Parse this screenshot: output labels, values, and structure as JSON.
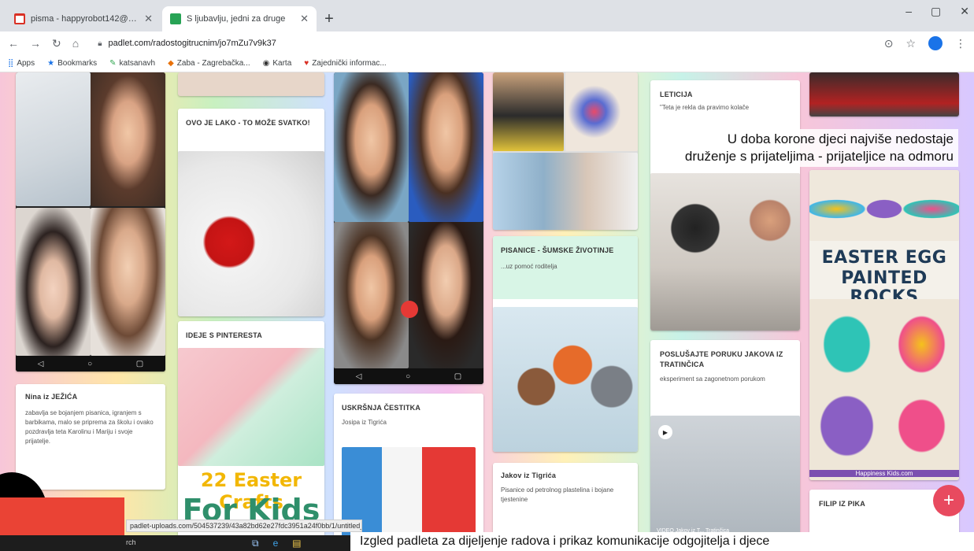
{
  "browser": {
    "tabs": [
      {
        "title": "pisma - happyrobot142@gmail",
        "icon": "gmail-icon",
        "active": false
      },
      {
        "title": "S ljubavlju, jedni za druge",
        "icon": "padlet-icon",
        "active": true
      }
    ],
    "new_tab": "+",
    "window_controls": {
      "minimize": "–",
      "maximize": "▢",
      "close": "✕"
    },
    "url": "padlet.com/radostogitrucnim/jo7mZu7v9k37",
    "bookmarks": [
      {
        "label": "Apps",
        "icon": "apps-icon"
      },
      {
        "label": "Bookmarks",
        "icon": "star-icon"
      },
      {
        "label": "katsanavh",
        "icon": "bookmark-icon"
      },
      {
        "label": "Zaba - Zagrebačka...",
        "icon": "bank-icon"
      },
      {
        "label": "Karta",
        "icon": "globe-icon"
      },
      {
        "label": "Zajednički informac...",
        "icon": "shield-icon"
      }
    ]
  },
  "board": {
    "overlay_caption": [
      "U doba korone djeci najviše nedostaje",
      "druženje s prijateljima - prijateljice na odmoru"
    ],
    "posts": {
      "nina": {
        "title": "Nina iz JEŽIĆA",
        "body": "zabavlja se bojanjem pisanica, igranjem s barbikama, malo se priprema za školu i ovako pozdravlja teta Karolinu i Mariju i svoje prijatelje."
      },
      "ovo": {
        "title": "OVO JE LAKO - TO MOŽE SVATKO!"
      },
      "ideje": {
        "title": "IDEJE S PINTERESTA",
        "crafts_line1": "22 Easter Crafts",
        "crafts_line2": "For Kids"
      },
      "uskrsnja": {
        "title": "USKRŠNJA ČESTITKA",
        "body": "Josipa iz Tigrića"
      },
      "pisanice": {
        "title": "PISANICE - ŠUMSKE ŽIVOTINJE",
        "body": "...uz pomoć roditelja"
      },
      "jakov": {
        "title": "Jakov iz Tigrića",
        "body": "Pisanice od petrolnog plastelina i bojane tjestenine"
      },
      "leticija": {
        "title": "LETICIJA",
        "body": "\"Teta je rekla da pravimo kolače"
      },
      "poslusajte": {
        "title": "POSLUŠAJTE PORUKU JAKOVA IZ TRATINČICA",
        "body": "eksperiment sa zagonetnom porukom",
        "video_caption": "VIDEO Jakov iz T... Tratinčica"
      },
      "easter": {
        "line1": "EASTER EGG",
        "line2": "PAINTED ROCKS",
        "credit": "Happiness Kids.com"
      },
      "filip": {
        "title": "FILIP IZ PIKA"
      }
    },
    "fab": "+"
  },
  "status": {
    "url": "padlet-uploads.com/504537239/43a82bd62e27fdc3951a24f0bb/1/untitled_design_74.png",
    "search_fragment": "rch"
  },
  "bottom_caption": "Izgled padleta za dijeljenje radova i prikaz komunikacije odgojitelja i djece"
}
